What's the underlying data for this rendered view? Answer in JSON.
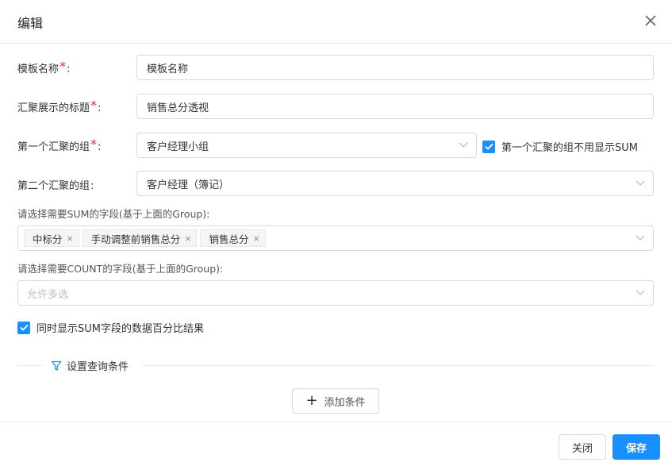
{
  "dialog": {
    "title": "编辑",
    "close_icon": "close-icon"
  },
  "fields": {
    "template_name": {
      "label": "模板名称",
      "required": "*",
      "colon": ":",
      "value": "模板名称"
    },
    "summary_title": {
      "label": "汇聚展示的标题",
      "required": "*",
      "colon": ":",
      "value": "销售总分透视"
    },
    "first_group": {
      "label": "第一个汇聚的组",
      "required": "*",
      "colon": ":",
      "value": "客户经理小组"
    },
    "first_group_option": {
      "label": "第一个汇聚的组不用显示SUM",
      "checked": true
    },
    "second_group": {
      "label": "第二个汇聚的组",
      "colon": ":",
      "value": "客户经理（簿记）"
    },
    "sum_fields": {
      "label": "请选择需要SUM的字段(基于上面的Group):",
      "tags": [
        {
          "text": "中标分",
          "remove": "×"
        },
        {
          "text": "手动调整前销售总分",
          "remove": "×"
        },
        {
          "text": "销售总分",
          "remove": "×"
        }
      ]
    },
    "count_fields": {
      "label": "请选择需要COUNT的字段(基于上面的Group):",
      "placeholder": "允许多选"
    },
    "show_percent": {
      "label": "同时显示SUM字段的数据百分比结果",
      "checked": true
    }
  },
  "conditions": {
    "section_label": "设置查询条件",
    "filter_icon": "filter-icon",
    "add_plus": "+",
    "add_label": "添加条件"
  },
  "footer": {
    "cancel_label": "关闭",
    "save_label": "保存"
  },
  "colors": {
    "primary": "#1890ff",
    "required": "#f5222d",
    "border": "#d9d9d9"
  }
}
